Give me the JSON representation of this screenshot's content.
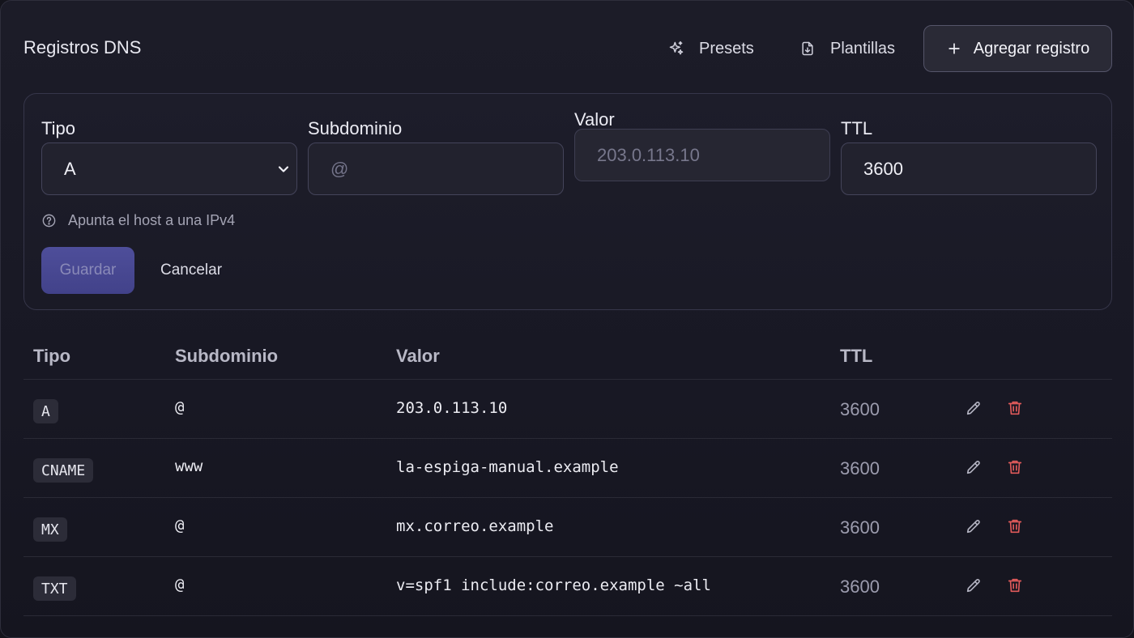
{
  "header": {
    "title": "Registros DNS",
    "presets_label": "Presets",
    "templates_label": "Plantillas",
    "add_label": "Agregar registro"
  },
  "form": {
    "type_label": "Tipo",
    "type_value": "A",
    "subdomain_label": "Subdominio",
    "subdomain_placeholder": "@",
    "value_label": "Valor",
    "value_value": "203.0.113.10",
    "ttl_label": "TTL",
    "ttl_value": "3600",
    "help_text": "Apunta el host a una IPv4",
    "save_label": "Guardar",
    "cancel_label": "Cancelar"
  },
  "table": {
    "headers": [
      "Tipo",
      "Subdominio",
      "Valor",
      "TTL"
    ],
    "rows": [
      {
        "type": "A",
        "subdomain": "@",
        "value": "203.0.113.10",
        "ttl": "3600"
      },
      {
        "type": "CNAME",
        "subdomain": "www",
        "value": "la-espiga-manual.example",
        "ttl": "3600"
      },
      {
        "type": "MX",
        "subdomain": "@",
        "value": "mx.correo.example",
        "ttl": "3600"
      },
      {
        "type": "TXT",
        "subdomain": "@",
        "value": "v=spf1 include:correo.example ~all",
        "ttl": "3600"
      }
    ]
  },
  "icons": {
    "presets": "sparkles-icon",
    "templates": "file-download-icon",
    "add": "plus-icon",
    "help": "question-circle-icon",
    "edit": "pencil-icon",
    "delete": "trash-icon"
  },
  "colors": {
    "accent": "#4a4a94",
    "danger": "#e05a5a"
  }
}
